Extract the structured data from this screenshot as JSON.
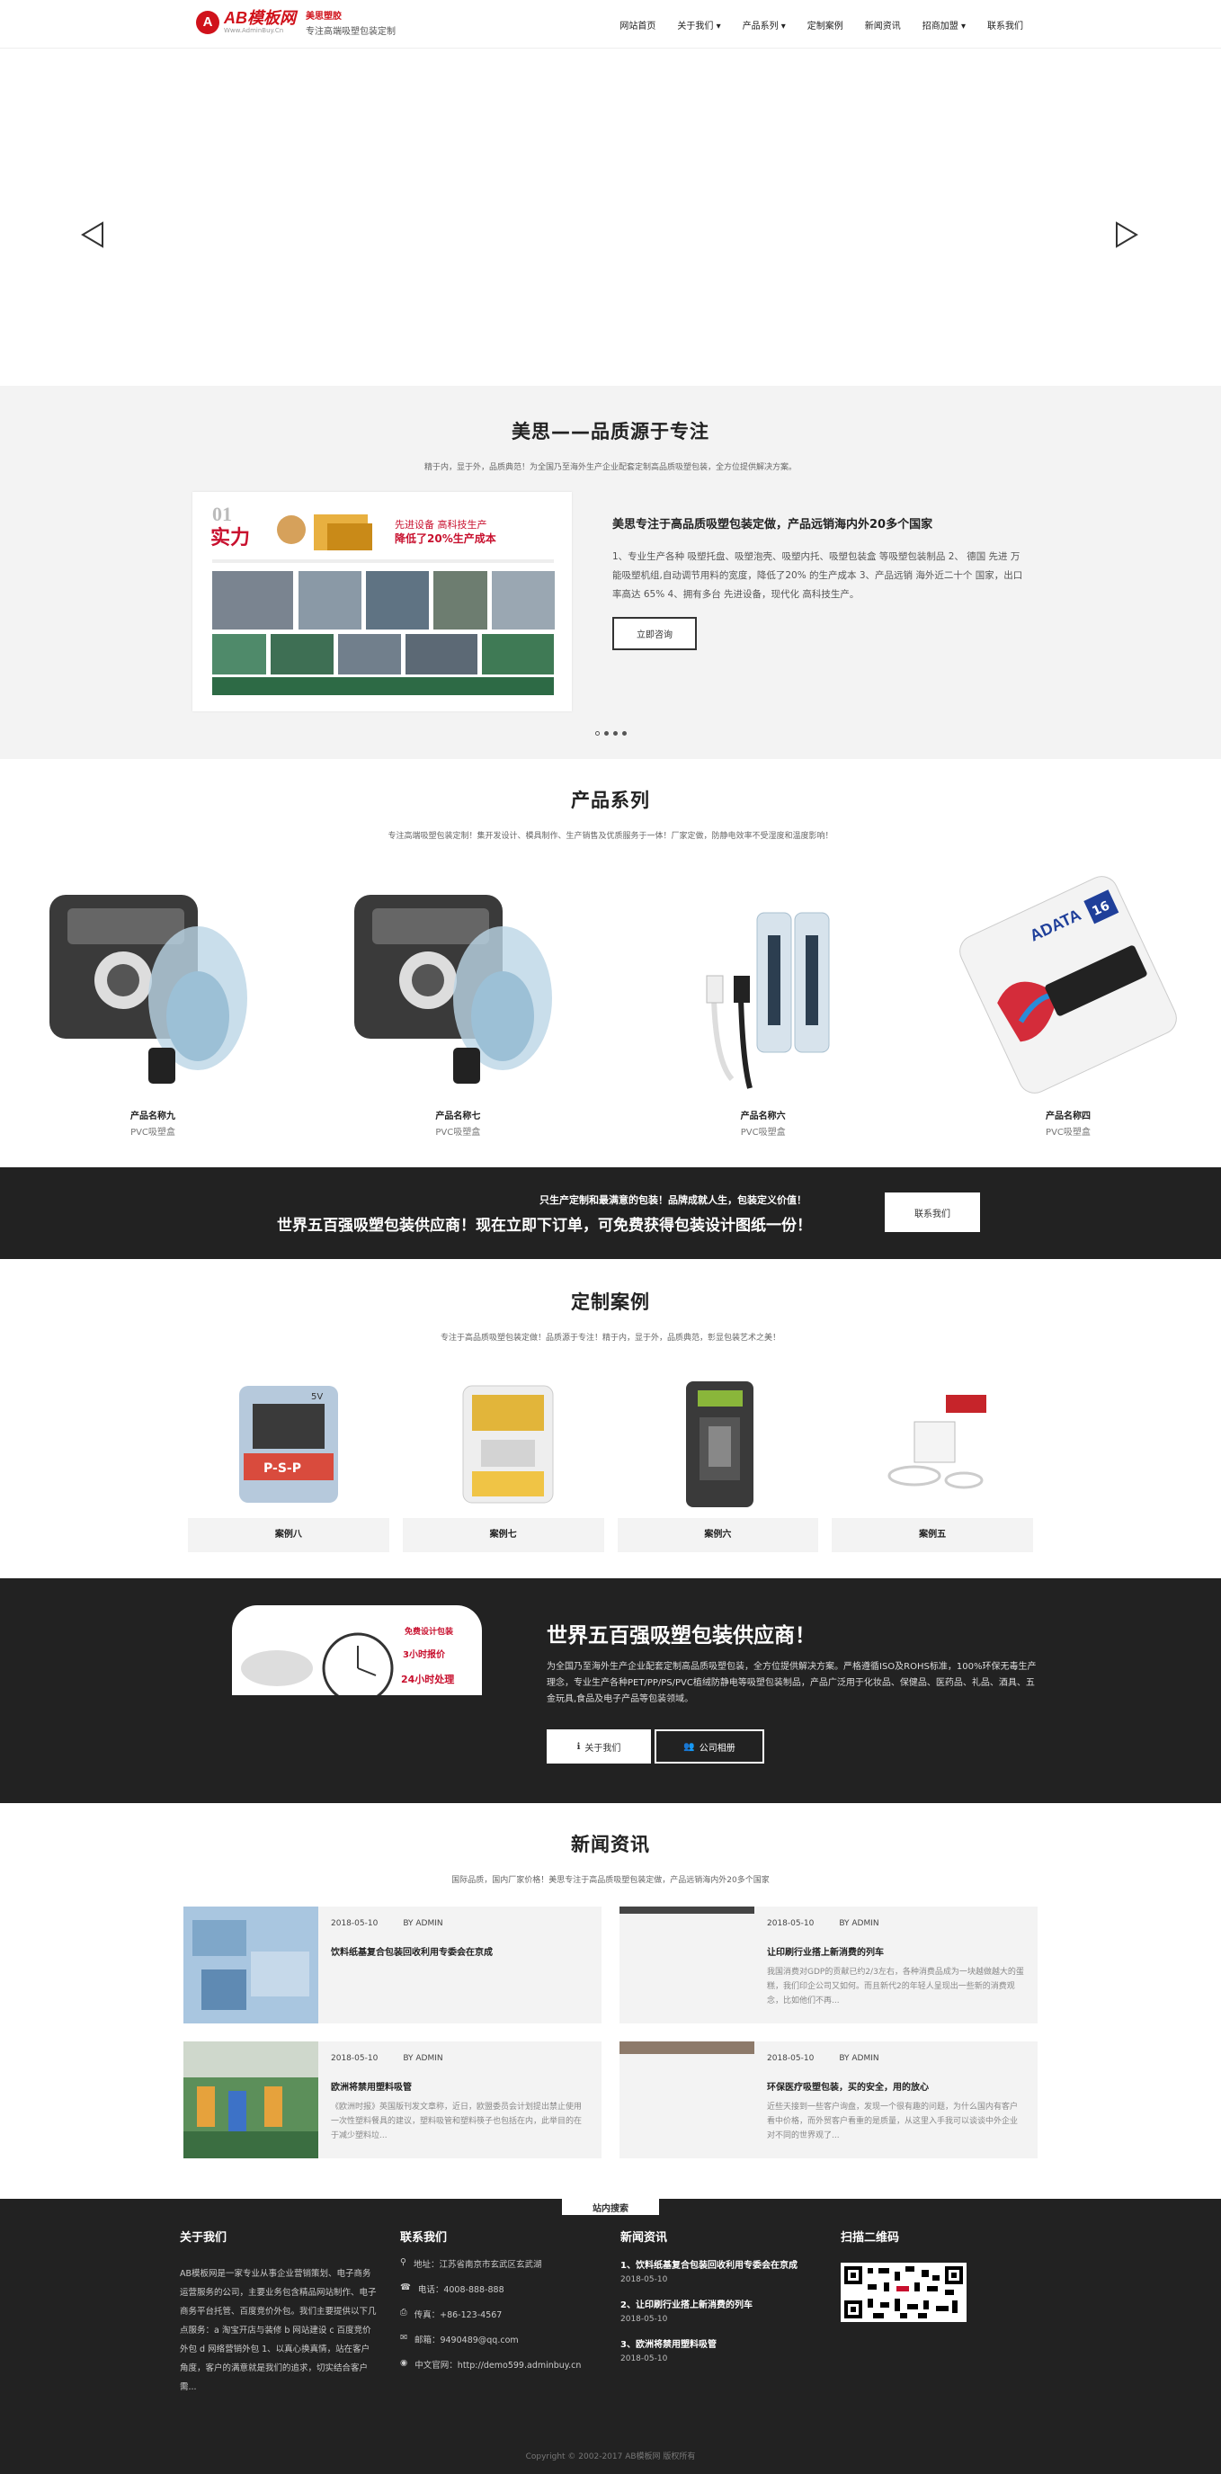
{
  "header": {
    "logo_text": "AB模板网",
    "logo_sub": "Www.AdminBuy.Cn",
    "brand_name": "美思塑胶",
    "brand_slogan": "专注高端吸塑包装定制",
    "nav": [
      "网站首页",
      "关于我们 ▾",
      "产品系列 ▾",
      "定制案例",
      "新闻资讯",
      "招商加盟 ▾",
      "联系我们"
    ]
  },
  "about": {
    "title": "美思——品质源于专注",
    "subtitle": "精于内，显于外，品质典范！为全国乃至海外生产企业配套定制高品质吸塑包装，全方位提供解决方案。",
    "heading": "美思专注于高品质吸塑包装定做，产品远销海内外20多个国家",
    "body": "1、专业生产各种 吸塑托盘、吸塑泡壳、吸塑内托、吸塑包装盒 等吸塑包装制品 2、 德国 先进 万能吸塑机组,自动调节用料的宽度，降低了20% 的生产成本 3、产品远销 海外近二十个 国家，出口率高达 65% 4、拥有多台 先进设备，现代化 高科技生产。",
    "button": "立即咨询",
    "image_labels": {
      "num": "01",
      "big": "实力",
      "red1": "先进设备  高科技生产",
      "red2": "降低了20%生产成本"
    }
  },
  "products": {
    "title": "产品系列",
    "subtitle": "专注高端吸塑包装定制！集开发设计、模具制作、生产销售及优质服务于一体！厂家定做，防静电效率不受湿度和温度影响！",
    "items": [
      {
        "name": "产品名称九",
        "type": "PVC吸塑盒"
      },
      {
        "name": "产品名称七",
        "type": "PVC吸塑盒"
      },
      {
        "name": "产品名称六",
        "type": "PVC吸塑盒"
      },
      {
        "name": "产品名称四",
        "type": "PVC吸塑盒"
      }
    ],
    "usb_brand": "ADATA",
    "usb_size": "16"
  },
  "cta": {
    "line1": "只生产定制和最满意的包装！品牌成就人生，包装定义价值！",
    "line2": "世界五百强吸塑包装供应商！现在立即下订单，可免费获得包装设计图纸一份！",
    "button": "联系我们"
  },
  "cases": {
    "title": "定制案例",
    "subtitle": "专注于高品质吸塑包装定做！品质源于专注！精于内，显于外，品质典范，彰显包装艺术之美！",
    "items": [
      {
        "name": "案例八"
      },
      {
        "name": "案例七"
      },
      {
        "name": "案例六"
      },
      {
        "name": "案例五"
      }
    ],
    "psp": "P-S-P",
    "psp_v": "5V"
  },
  "dark": {
    "title": "世界五百强吸塑包装供应商！",
    "body": "为全国乃至海外生产企业配套定制高品质吸塑包装，全方位提供解决方案。严格遵循ISO及ROHS标准，100%环保无毒生产理念，专业生产各种PET/PP/PS/PVC植绒防静电等吸塑包装制品，产品广泛用于化妆品、保健品、医药品、礼品、酒具、五金玩具,食品及电子产品等包装领域。",
    "btn1": "关于我们",
    "btn2": "公司相册",
    "img_labels": [
      "免费设计包装",
      "3小时报价",
      "24小时处理"
    ]
  },
  "news": {
    "title": "新闻资讯",
    "subtitle": "国际品质，国内厂家价格！美思专注于高品质吸塑包装定做，产品远销海内外20多个国家",
    "items": [
      {
        "date": "2018-05-10",
        "author": "BY ADMIN",
        "title": "饮料纸基复合包装回收利用专委会在京成",
        "body": ""
      },
      {
        "date": "2018-05-10",
        "author": "BY ADMIN",
        "title": "让印刷行业搭上新消费的列车",
        "body": "我国消费对GDP的贡献已约2/3左右，各种消费品成为一块越做越大的蛋糕，我们印企公司又如何。而且新代2的年轻人呈现出一些新的消费观念，比如他们不再..."
      },
      {
        "date": "2018-05-10",
        "author": "BY ADMIN",
        "title": "欧洲将禁用塑料吸管",
        "body": "《欧洲时报》英国版刊发文章称，近日，欧盟委员会计划提出禁止使用一次性塑料餐具的建议，塑料吸管和塑料筷子也包括在内，此举目的在于减少塑料垃..."
      },
      {
        "date": "2018-05-10",
        "author": "BY ADMIN",
        "title": "环保医疗吸塑包装，买的安全，用的放心",
        "body": "近些天接到一些客户询盘，发现一个很有趣的问题，为什么国内有客户看中价格，而外贸客户看重的是质量，从这里入手我可以谈谈中外企业对不同的世界观了..."
      }
    ]
  },
  "footer": {
    "search_tab": "站内搜索",
    "col1_title": "关于我们",
    "col1_body": "AB模板网是一家专业从事企业营销策划、电子商务运营服务的公司，主要业务包含精品网站制作、电子商务平台托管、百度竞价外包。我们主要提供以下几点服务：a 淘宝开店与装修 b 网站建设 c 百度竞价外包 d 网络营销外包 1、以真心换真情，站在客户角度，客户的满意就是我们的追求，切实结合客户需...",
    "col2_title": "联系我们",
    "contacts": [
      {
        "icon": "map-pin-icon",
        "text": "地址：江苏省南京市玄武区玄武湖"
      },
      {
        "icon": "phone-icon",
        "text": "电话：4008-888-888"
      },
      {
        "icon": "fax-icon",
        "text": "传真：+86-123-4567"
      },
      {
        "icon": "mail-icon",
        "text": "邮箱：9490489@qq.com"
      },
      {
        "icon": "globe-icon",
        "text": "中文官网：http://demo599.adminbuy.cn"
      }
    ],
    "col3_title": "新闻资讯",
    "footer_news": [
      {
        "title": "1、饮料纸基复合包装回收利用专委会在京成",
        "date": "2018-05-10"
      },
      {
        "title": "2、让印刷行业搭上新消费的列车",
        "date": "2018-05-10"
      },
      {
        "title": "3、欧洲将禁用塑料吸管",
        "date": "2018-05-10"
      }
    ],
    "col4_title": "扫描二维码",
    "copyright": "Copyright © 2002-2017 AB模板网 版权所有"
  }
}
